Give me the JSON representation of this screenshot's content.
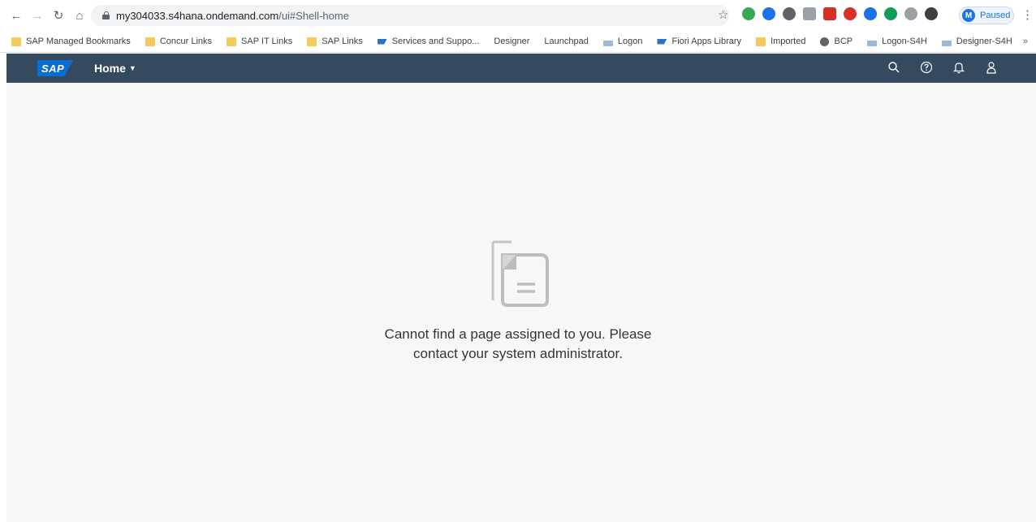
{
  "browser": {
    "url_host": "my304033.s4hana.ondemand.com",
    "url_path": "/ui#Shell-home",
    "profile_initial": "M",
    "profile_status": "Paused",
    "extension_colors": [
      "#34a853",
      "#1a73e8",
      "#5f6368",
      "#9aa0a6",
      "#d93025",
      "#d93025",
      "#1a73e8",
      "#0f9d58",
      "#9aa0a6",
      "#3c4043"
    ]
  },
  "bookmarks": [
    {
      "label": "SAP Managed Bookmarks",
      "icon": "folder-icon"
    },
    {
      "label": "Concur Links",
      "icon": "folder-icon"
    },
    {
      "label": "SAP IT Links",
      "icon": "folder-icon"
    },
    {
      "label": "SAP Links",
      "icon": "folder-icon"
    },
    {
      "label": "Services and Suppo...",
      "icon": "sap-icon"
    },
    {
      "label": "Designer",
      "icon": ""
    },
    {
      "label": "Launchpad",
      "icon": ""
    },
    {
      "label": "Logon",
      "icon": "page-icon"
    },
    {
      "label": "Fiori Apps Library",
      "icon": "sap-icon"
    },
    {
      "label": "Imported",
      "icon": "folder-icon"
    },
    {
      "label": "BCP",
      "icon": "globe-icon"
    },
    {
      "label": "Logon-S4H",
      "icon": "page-icon"
    },
    {
      "label": "Designer-S4H",
      "icon": "page-icon"
    }
  ],
  "bookmarks_more": "»",
  "shell": {
    "logo": "SAP",
    "home_label": "Home",
    "colors": {
      "header": "#354a5f",
      "brand": "#0a6ed1",
      "content_bg": "#f7f7f7"
    }
  },
  "empty_state": {
    "line1": "Cannot find a page assigned to you. Please",
    "line2": "contact your system administrator."
  }
}
